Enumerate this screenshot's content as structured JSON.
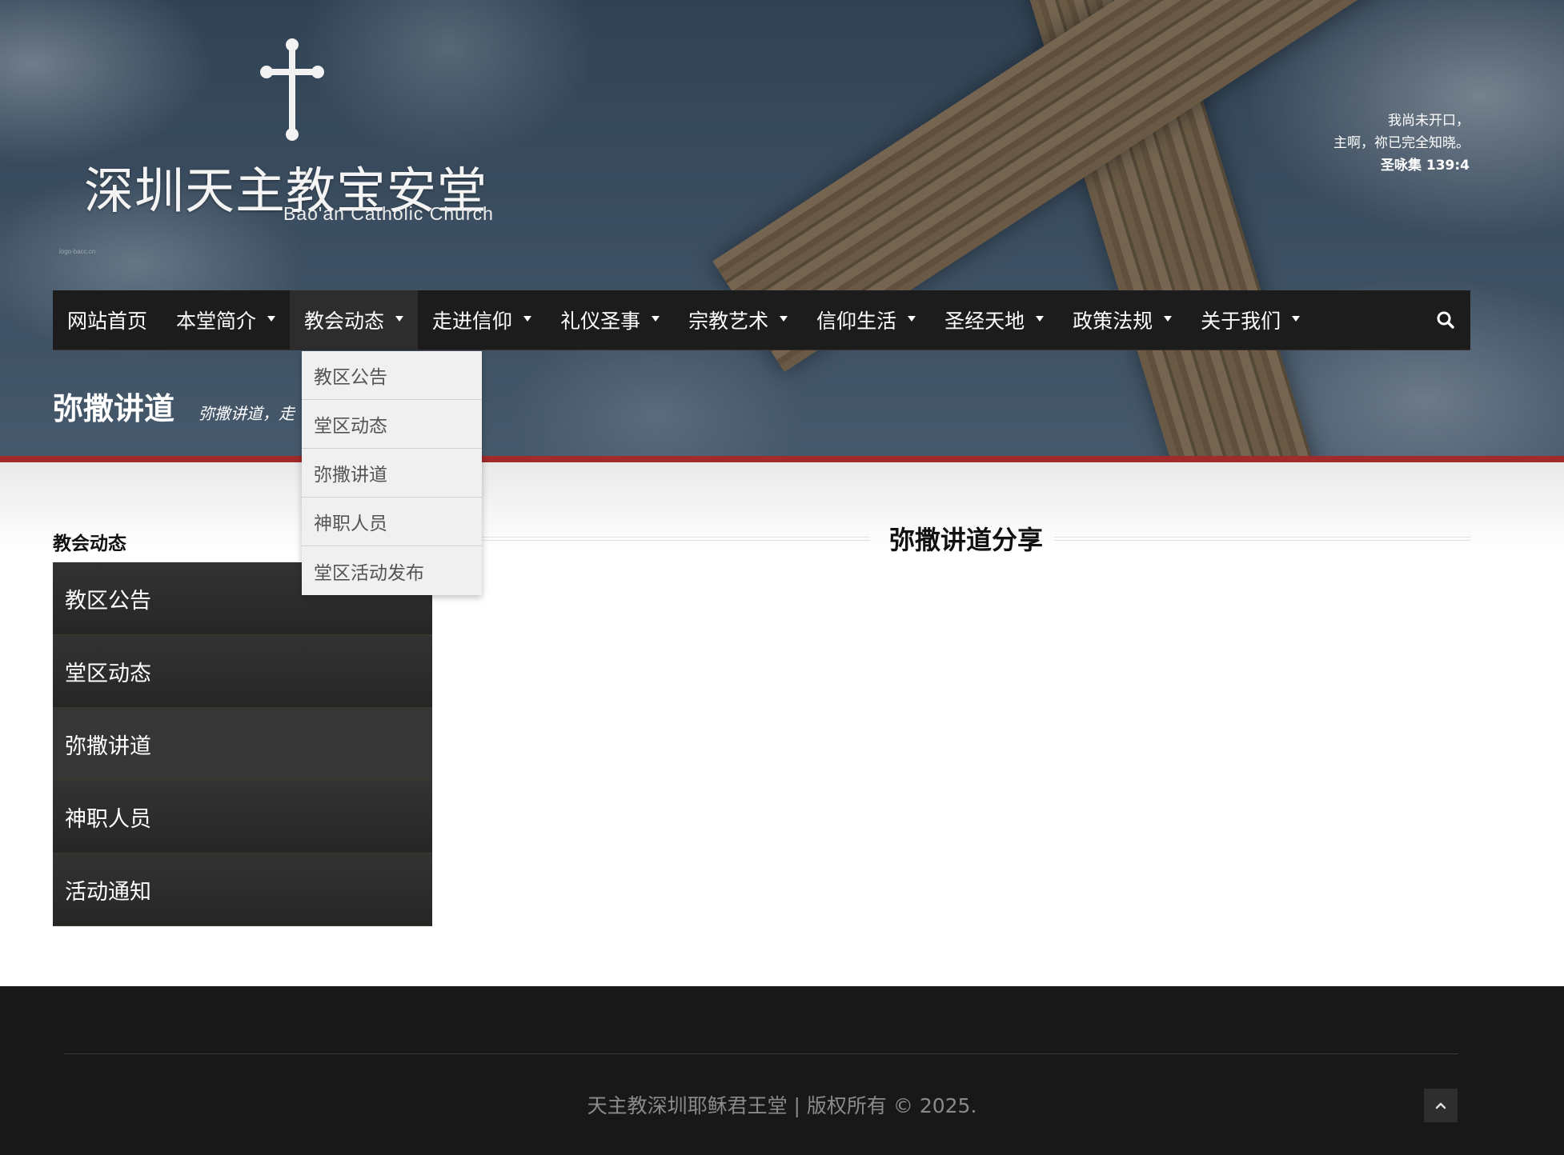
{
  "header": {
    "logo_title": "深圳天主教宝安堂",
    "logo_subtitle": "Bao'an Catholic Church",
    "logo_tiny": "logo-bacc.cn",
    "quote_line1": "我尚未开口，",
    "quote_line2": "主啊，祢已完全知晓。",
    "quote_ref": "圣咏集 139:4"
  },
  "nav": {
    "items": [
      {
        "label": "网站首页",
        "has_caret": false
      },
      {
        "label": "本堂简介",
        "has_caret": true
      },
      {
        "label": "教会动态",
        "has_caret": true,
        "active": true
      },
      {
        "label": "走进信仰",
        "has_caret": true
      },
      {
        "label": "礼仪圣事",
        "has_caret": true
      },
      {
        "label": "宗教艺术",
        "has_caret": true
      },
      {
        "label": "信仰生活",
        "has_caret": true
      },
      {
        "label": "圣经天地",
        "has_caret": true
      },
      {
        "label": "政策法规",
        "has_caret": true
      },
      {
        "label": "关于我们",
        "has_caret": true
      }
    ],
    "search_icon": "search-icon"
  },
  "dropdown": {
    "items": [
      "教区公告",
      "堂区动态",
      "弥撒讲道",
      "神职人员",
      "堂区活动发布"
    ]
  },
  "page": {
    "title": "弥撒讲道",
    "description": "弥撒讲道，走"
  },
  "sidebar": {
    "title": "教会动态",
    "items": [
      "教区公告",
      "堂区动态",
      "弥撒讲道",
      "神职人员",
      "活动通知"
    ],
    "active_index": 2
  },
  "main": {
    "heading": "弥撒讲道分享"
  },
  "footer": {
    "copyright": "天主教深圳耶稣君王堂 | 版权所有 © 2025.",
    "back_to_top_icon": "chevron-up-icon"
  },
  "colors": {
    "nav_bg": "#1c1c1c",
    "accent_red": "#a12a2a",
    "footer_bg": "#181818"
  }
}
